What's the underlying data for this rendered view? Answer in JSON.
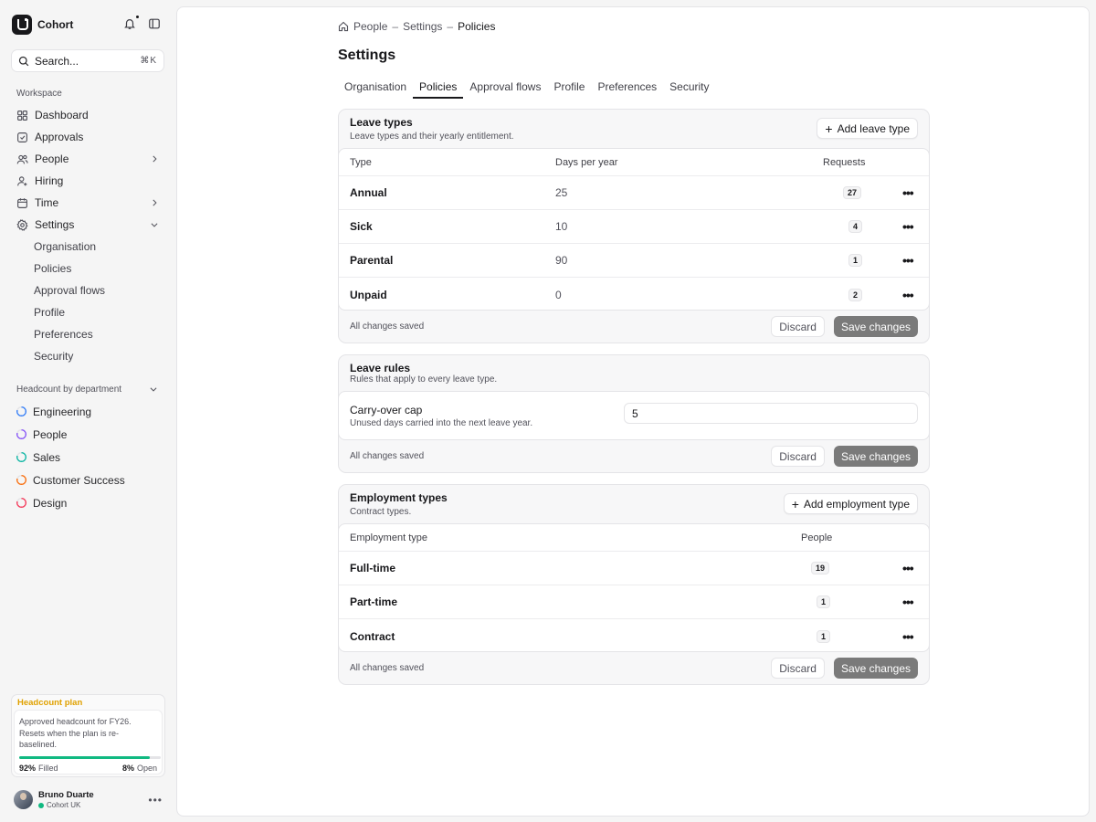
{
  "app": {
    "name": "Cohort",
    "search_placeholder": "Search...",
    "search_shortcut": "⌘K"
  },
  "sidebar": {
    "workspace_label": "Workspace",
    "items": [
      {
        "label": "Dashboard",
        "icon": "grid-icon"
      },
      {
        "label": "Approvals",
        "icon": "check-square-icon"
      },
      {
        "label": "People",
        "icon": "users-icon"
      },
      {
        "label": "Hiring",
        "icon": "user-plus-icon"
      },
      {
        "label": "Time",
        "icon": "calendar-icon"
      },
      {
        "label": "Settings",
        "icon": "gear-icon"
      }
    ],
    "settings_sub": [
      "Organisation",
      "Policies",
      "Approval flows",
      "Profile",
      "Preferences",
      "Security"
    ],
    "active_sub": "Policies",
    "departments_label": "Headcount by department",
    "departments": [
      {
        "label": "Engineering",
        "color": "#3b82f6"
      },
      {
        "label": "People",
        "color": "#8b5cf6"
      },
      {
        "label": "Sales",
        "color": "#14b8a6"
      },
      {
        "label": "Customer Success",
        "color": "#f97316"
      },
      {
        "label": "Design",
        "color": "#f43f5e"
      }
    ]
  },
  "plan": {
    "title": "Headcount plan",
    "desc": "Approved headcount for FY26. Resets when the plan is re-baselined.",
    "filled_pct": "92%",
    "filled_label": "Filled",
    "open_pct": "8%",
    "open_label": "Open",
    "filled_fraction": 0.92
  },
  "user": {
    "name": "Bruno Duarte",
    "org": "Cohort UK"
  },
  "breadcrumb": [
    "People",
    "Settings",
    "Policies"
  ],
  "page_title": "Settings",
  "tabs": [
    "Organisation",
    "Policies",
    "Approval flows",
    "Profile",
    "Preferences",
    "Security"
  ],
  "active_tab": "Policies",
  "leave_types": {
    "title": "Leave types",
    "subtitle": "Leave types and their yearly entitlement.",
    "add_label": "Add leave type",
    "columns": [
      "Type",
      "Days per year",
      "Requests"
    ],
    "rows": [
      {
        "type": "Annual",
        "days": "25",
        "requests": "27"
      },
      {
        "type": "Sick",
        "days": "10",
        "requests": "4"
      },
      {
        "type": "Parental",
        "days": "90",
        "requests": "1"
      },
      {
        "type": "Unpaid",
        "days": "0",
        "requests": "2"
      }
    ],
    "status": "All changes saved",
    "discard": "Discard",
    "save": "Save changes"
  },
  "leave_rules": {
    "title": "Leave rules",
    "subtitle": "Rules that apply to every leave type.",
    "field_label": "Carry-over cap",
    "field_help": "Unused days carried into the next leave year.",
    "field_value": "5",
    "status": "All changes saved",
    "discard": "Discard",
    "save": "Save changes"
  },
  "employment_types": {
    "title": "Employment types",
    "subtitle": "Contract types.",
    "add_label": "Add employment type",
    "columns": [
      "Employment type",
      "People"
    ],
    "rows": [
      {
        "type": "Full-time",
        "people": "19"
      },
      {
        "type": "Part-time",
        "people": "1"
      },
      {
        "type": "Contract",
        "people": "1"
      }
    ],
    "status": "All changes saved",
    "discard": "Discard",
    "save": "Save changes"
  }
}
